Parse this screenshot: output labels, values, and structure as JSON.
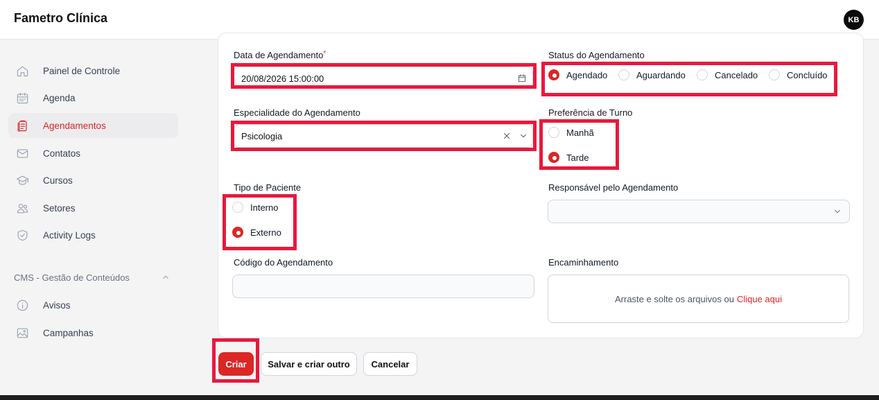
{
  "app": {
    "title": "Fametro Clínica",
    "avatar_initials": "KB"
  },
  "sidebar": {
    "items": [
      {
        "label": "Painel de Controle",
        "icon": "home-icon"
      },
      {
        "label": "Agenda",
        "icon": "calendar-icon"
      },
      {
        "label": "Agendamentos",
        "icon": "clipboard-icon",
        "active": true
      },
      {
        "label": "Contatos",
        "icon": "mail-icon"
      },
      {
        "label": "Cursos",
        "icon": "graduation-cap-icon"
      },
      {
        "label": "Setores",
        "icon": "users-icon"
      },
      {
        "label": "Activity Logs",
        "icon": "shield-check-icon"
      }
    ],
    "group_label": "CMS - Gestão de Conteúdos",
    "group_items": [
      {
        "label": "Avisos",
        "icon": "info-icon"
      },
      {
        "label": "Campanhas",
        "icon": "image-icon"
      }
    ]
  },
  "form": {
    "data_agendamento": {
      "label": "Data de Agendamento",
      "required_mark": "*",
      "value": "20/08/2026 15:00:00"
    },
    "status": {
      "label": "Status do Agendamento",
      "options": [
        "Agendado",
        "Aguardando",
        "Cancelado",
        "Concluído"
      ],
      "selected": "Agendado"
    },
    "especialidade": {
      "label": "Especialidade do Agendamento",
      "value": "Psicologia"
    },
    "turno": {
      "label": "Preferência de Turno",
      "options": [
        "Manhã",
        "Tarde"
      ],
      "selected": "Tarde"
    },
    "tipo_paciente": {
      "label": "Tipo de Paciente",
      "options": [
        "Interno",
        "Externo"
      ],
      "selected": "Externo"
    },
    "responsavel": {
      "label": "Responsável pelo Agendamento",
      "value": ""
    },
    "codigo": {
      "label": "Código do Agendamento",
      "value": ""
    },
    "encaminhamento": {
      "label": "Encaminhamento",
      "drop_text": "Arraste e solte os arquivos ou",
      "drop_link": "Clique aqui"
    }
  },
  "actions": {
    "create": "Criar",
    "save_create_another": "Salvar e criar outro",
    "cancel": "Cancelar"
  },
  "colors": {
    "accent": "#dc2626",
    "highlight": "#e8193c"
  }
}
